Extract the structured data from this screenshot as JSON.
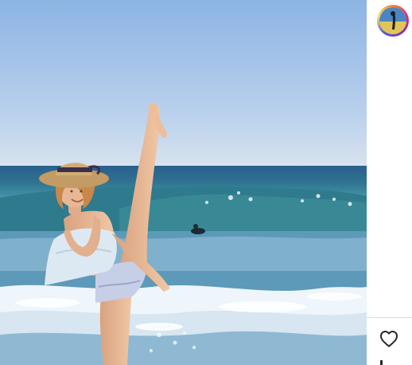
{
  "post": {
    "media": {
      "type": "photo",
      "scene": "beach-high-kick",
      "colors": {
        "sky_top": "#8fb7e6",
        "sky_horizon": "#d6e1ef",
        "sea": "#2f6f9a",
        "wave": "#3c8a9a",
        "foam": "#eef5fb",
        "hat": "#c9a36a",
        "top": "#dce9f2",
        "bottoms": "#c8cfe6"
      }
    },
    "author": {
      "avatar_icon": "profile-avatar-icon",
      "ring_colors": [
        "#f58529",
        "#dd2a7b",
        "#8134af",
        "#515bd4",
        "#feda77"
      ]
    },
    "actions": {
      "like_icon": "heart-icon",
      "like_color": "#262626"
    }
  }
}
